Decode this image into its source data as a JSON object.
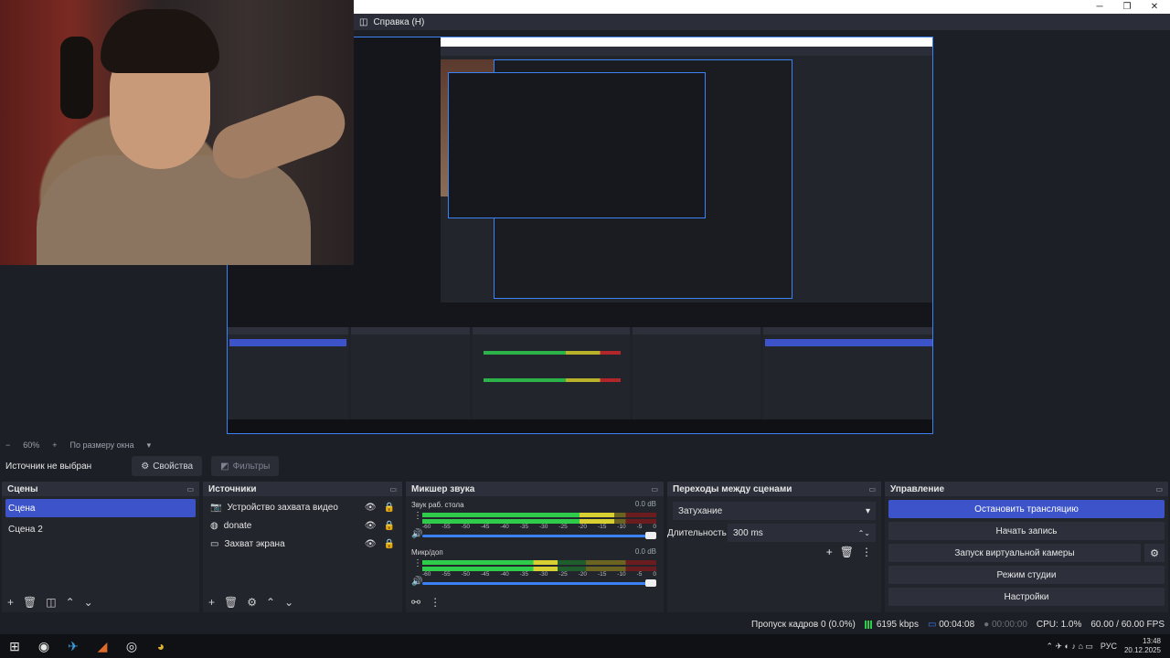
{
  "menubar": {
    "help_icon": "help-icon",
    "help_label": "Справка (H)"
  },
  "preview_zoom": {
    "zoom": "60%",
    "fit": "По размеру окна"
  },
  "source_bar": {
    "none_selected": "Источник не выбран",
    "properties": "Свойства",
    "filters": "Фильтры"
  },
  "scenes": {
    "title": "Сцены",
    "items": [
      {
        "label": "Сцена",
        "selected": true
      },
      {
        "label": "Сцена 2",
        "selected": false
      }
    ]
  },
  "sources": {
    "title": "Источники",
    "items": [
      {
        "label": "Устройство захвата видео",
        "icon": "camera-icon"
      },
      {
        "label": "donate",
        "icon": "globe-icon"
      },
      {
        "label": "Захват экрана",
        "icon": "monitor-icon"
      }
    ]
  },
  "mixer": {
    "title": "Микшер звука",
    "channels": [
      {
        "label": "Звук раб. стола",
        "db": "0.0 dB",
        "level": 0.82
      },
      {
        "label": "Микр/доп",
        "db": "0.0 dB",
        "level": 0.58
      }
    ],
    "ticks": [
      "-60",
      "-55",
      "-50",
      "-45",
      "-40",
      "-35",
      "-30",
      "-25",
      "-20",
      "-15",
      "-10",
      "-5",
      "0"
    ]
  },
  "transitions": {
    "title": "Переходы между сценами",
    "type": "Затухание",
    "duration_label": "Длительность",
    "duration": "300 ms"
  },
  "controls": {
    "title": "Управление",
    "stop_stream": "Остановить трансляцию",
    "start_record": "Начать запись",
    "virtual_cam": "Запуск виртуальной камеры",
    "studio_mode": "Режим студии",
    "settings": "Настройки"
  },
  "status": {
    "dropped": "Пропуск кадров 0 (0.0%)",
    "bitrate": "6195 kbps",
    "stream_time": "00:04:08",
    "record_time": "00:00:00",
    "cpu": "CPU: 1.0%",
    "fps": "60.00 / 60.00 FPS"
  },
  "taskbar": {
    "lang": "РУС",
    "time": "13:48",
    "date": "20.12.2025"
  },
  "colors": {
    "accent": "#3c53c9",
    "panel": "#23252d",
    "meter_green": "#2ecc4a"
  }
}
